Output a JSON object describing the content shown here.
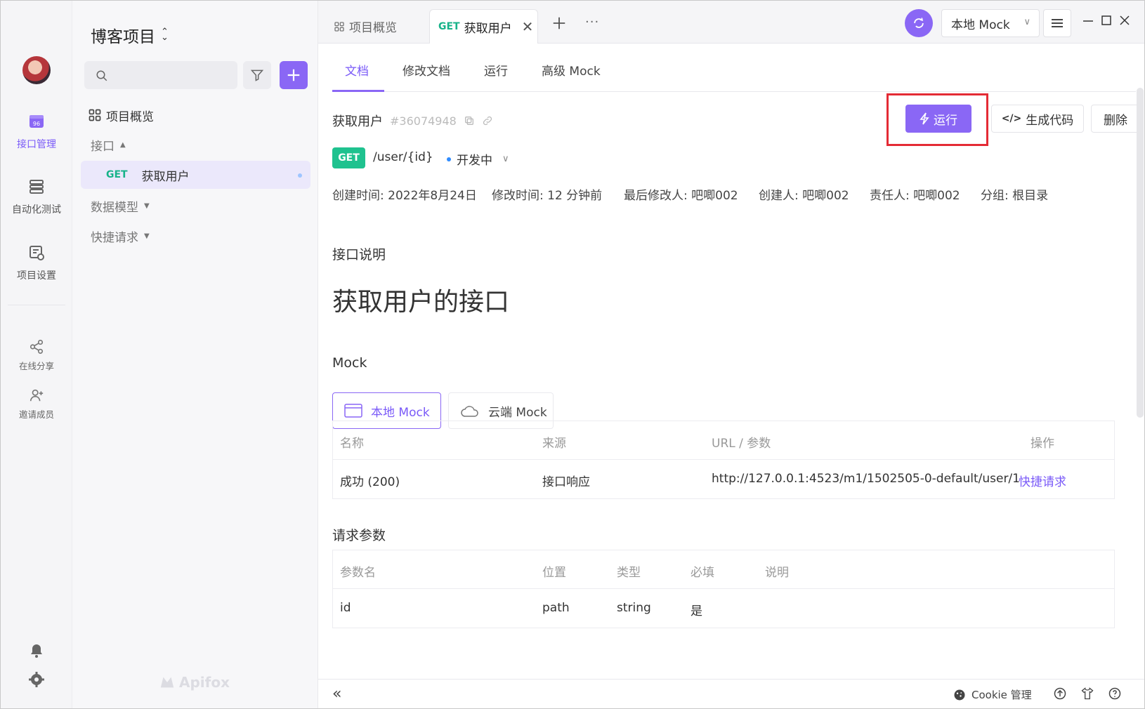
{
  "rail": {
    "items": [
      {
        "label": "接口管理",
        "icon": "api-management-icon",
        "active": true
      },
      {
        "label": "自动化测试",
        "icon": "automation-test-icon",
        "active": false
      },
      {
        "label": "项目设置",
        "icon": "project-settings-icon",
        "active": false
      }
    ],
    "secondary": [
      {
        "label": "在线分享",
        "icon": "share-icon"
      },
      {
        "label": "邀请成员",
        "icon": "invite-member-icon"
      }
    ]
  },
  "tree": {
    "project_title": "博客项目",
    "search_placeholder": "",
    "overview": "项目概览",
    "api_group": "接口",
    "selected_api_method": "GET",
    "selected_api_name": "获取用户",
    "data_models": "数据模型",
    "quick_requests": "快捷请求",
    "logo_text": "Apifox"
  },
  "tabs": {
    "overview_tab": "项目概览",
    "active_tab_method": "GET",
    "active_tab_name": "获取用户",
    "more": "···"
  },
  "topbar": {
    "env": "本地 Mock"
  },
  "subtabs": [
    "文档",
    "修改文档",
    "运行",
    "高级 Mock"
  ],
  "api": {
    "name": "获取用户",
    "id": "#36074948",
    "run_label": "运行",
    "gen_code_label": "生成代码",
    "delete_label": "删除",
    "method": "GET",
    "path": "/user/{id}",
    "status": "开发中",
    "meta": {
      "created": "创建时间: 2022年8月24日",
      "modified": "修改时间: 12 分钟前",
      "last_editor": "最后修改人: 吧唧002",
      "creator": "创建人: 吧唧002",
      "owner": "责任人: 吧唧002",
      "group": "分组: 根目录"
    },
    "desc_title": "接口说明",
    "desc_body": "获取用户的接口"
  },
  "mock": {
    "title": "Mock",
    "local_tab": "本地 Mock",
    "cloud_tab": "云端 Mock",
    "headers": [
      "名称",
      "来源",
      "URL / 参数",
      "操作"
    ],
    "rows": [
      {
        "name": "成功 (200)",
        "source": "接口响应",
        "url": "http://127.0.0.1:4523/m1/1502505-0-default/user/1",
        "action": "快捷请求"
      }
    ]
  },
  "params": {
    "title": "请求参数",
    "headers": [
      "参数名",
      "位置",
      "类型",
      "必填",
      "说明"
    ],
    "rows": [
      {
        "name": "id",
        "location": "path",
        "type": "string",
        "required": "是",
        "desc": ""
      }
    ]
  },
  "footer": {
    "cookie": "Cookie 管理"
  },
  "colors": {
    "accent": "#8a67f5",
    "get_green": "#1fc28f",
    "highlight_red": "#e42b35"
  }
}
